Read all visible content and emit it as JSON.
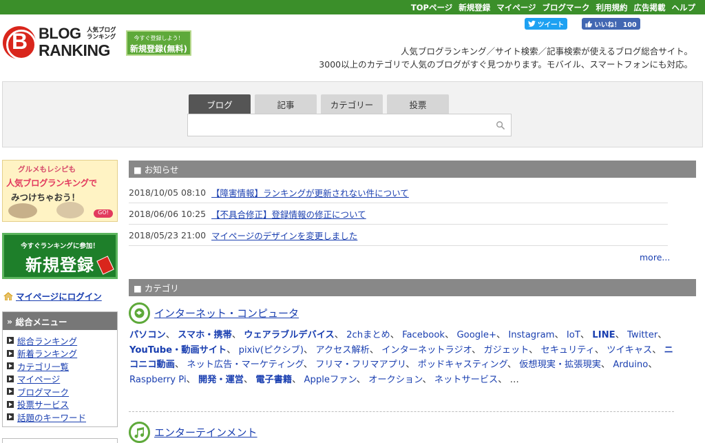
{
  "topnav": [
    "TOPページ",
    "新規登録",
    "マイページ",
    "ブログマーク",
    "利用規約",
    "広告掲載",
    "ヘルプ"
  ],
  "logo": {
    "line1": "BLOG",
    "line2": "RANKING",
    "sub": "人気ブログランキング"
  },
  "header_button": {
    "small": "今すぐ登録しよう！",
    "big": "新規登録(無料)"
  },
  "social": {
    "tweet": "ツイート",
    "like": "いいね！ 100"
  },
  "tagline": [
    "人気ブログランキング／サイト検索／記事検索が使えるブログ総合サイト。",
    "3000以上のカテゴリで人気のブログがすぐ見つかります。モバイル、スマートフォンにも対応。"
  ],
  "search": {
    "tabs": [
      "ブログ",
      "記事",
      "カテゴリー",
      "投票"
    ],
    "placeholder": ""
  },
  "left": {
    "gourmet_banner": {
      "line1": "グルメもレシピも",
      "line2": "人気ブログランキングで",
      "line3": "みつけちゃおう！",
      "go": "GO!"
    },
    "register_banner": {
      "small": "今すぐランキングに参加！",
      "big": "新規登録"
    },
    "mypage_login": "マイページにログイン",
    "menu_title": "総合メニュー",
    "menu_items": [
      "総合ランキング",
      "新着ランキング",
      "カテゴリ一覧",
      "マイページ",
      "ブログマーク",
      "投票サービス",
      "話題のキーワード"
    ]
  },
  "news": {
    "title": "■ お知らせ",
    "items": [
      {
        "date": "2018/10/05 08:10",
        "title": "【障害情報】ランキングが更新されない件について"
      },
      {
        "date": "2018/06/06 10:25",
        "title": "【不具合修正】登録情報の修正について"
      },
      {
        "date": "2018/05/23 21:00",
        "title": "マイページのデザインを変更しました"
      }
    ],
    "more": "more..."
  },
  "category": {
    "title": "■ カテゴリ",
    "groups": [
      {
        "name": "インターネット・コンピュータ",
        "links": [
          {
            "t": "パソコン",
            "b": true
          },
          {
            "t": "スマホ・携帯",
            "b": true
          },
          {
            "t": "ウェアラブルデバイス",
            "b": true
          },
          {
            "t": "2chまとめ",
            "b": false
          },
          {
            "t": "Facebook",
            "b": false
          },
          {
            "t": "Google+",
            "b": false
          },
          {
            "t": "Instagram",
            "b": false
          },
          {
            "t": "IoT",
            "b": false
          },
          {
            "t": "LINE",
            "b": true
          },
          {
            "t": "Twitter",
            "b": false
          },
          {
            "t": "YouTube・動画サイト",
            "b": true
          },
          {
            "t": "pixiv(ピクシブ)",
            "b": false
          },
          {
            "t": "アクセス解析",
            "b": false
          },
          {
            "t": "インターネットラジオ",
            "b": false
          },
          {
            "t": "ガジェット",
            "b": false
          },
          {
            "t": "セキュリティ",
            "b": false
          },
          {
            "t": "ツイキャス",
            "b": false
          },
          {
            "t": "ニコニコ動画",
            "b": true
          },
          {
            "t": "ネット広告・マーケティング",
            "b": false
          },
          {
            "t": "フリマ・フリマアプリ",
            "b": false
          },
          {
            "t": "ポッドキャスティング",
            "b": false
          },
          {
            "t": "仮想現実・拡張現実",
            "b": false
          },
          {
            "t": "Arduino",
            "b": false
          },
          {
            "t": "Raspberry Pi",
            "b": false
          },
          {
            "t": "開発・運営",
            "b": true
          },
          {
            "t": "電子書籍",
            "b": true
          },
          {
            "t": "Appleファン",
            "b": false
          },
          {
            "t": "オークション",
            "b": false
          },
          {
            "t": "ネットサービス",
            "b": false
          }
        ],
        "ellipsis": "…"
      },
      {
        "name": "エンターテインメント"
      }
    ]
  },
  "colors": {
    "topbar": "#3b8f2a",
    "link": "#1a3fb0",
    "section_head": "#888888"
  }
}
